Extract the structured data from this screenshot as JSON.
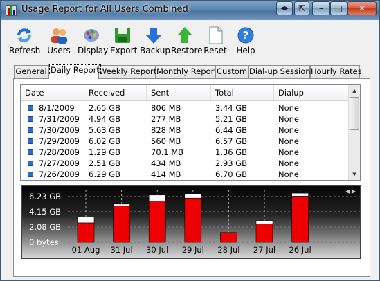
{
  "window": {
    "title": "Usage Report for All Users Combined",
    "buttons": {
      "nav": "◀▶",
      "restore": "⇱",
      "minimize": "–",
      "maximize": "□",
      "close": "✕"
    }
  },
  "toolbar": [
    {
      "label": "Refresh",
      "icon": "refresh-icon"
    },
    {
      "label": "Users",
      "icon": "users-icon"
    },
    {
      "label": "Display",
      "icon": "display-icon"
    },
    {
      "label": "Export",
      "icon": "export-icon"
    },
    {
      "label": "Backup",
      "icon": "backup-icon"
    },
    {
      "label": "Restore",
      "icon": "restore-icon"
    },
    {
      "label": "Reset",
      "icon": "reset-icon"
    },
    {
      "label": "Help",
      "icon": "help-icon"
    }
  ],
  "tabs": [
    "General",
    "Daily Report",
    "Weekly Report",
    "Monthly Report",
    "Custom",
    "Dial-up Sessions",
    "Hourly Rates"
  ],
  "active_tab": "Daily Report",
  "table": {
    "columns": [
      "Date",
      "Received",
      "Sent",
      "Total",
      "Dialup"
    ],
    "rows": [
      [
        "8/1/2009",
        "2.65 GB",
        "806 MB",
        "3.44 GB",
        "None"
      ],
      [
        "7/31/2009",
        "4.94 GB",
        "277 MB",
        "5.21 GB",
        "None"
      ],
      [
        "7/30/2009",
        "5.63 GB",
        "828 MB",
        "6.44 GB",
        "None"
      ],
      [
        "7/29/2009",
        "6.02 GB",
        "560 MB",
        "6.57 GB",
        "None"
      ],
      [
        "7/28/2009",
        "1.29 GB",
        "70.1 MB",
        "1.36 GB",
        "None"
      ],
      [
        "7/27/2009",
        "2.51 GB",
        "434 MB",
        "2.93 GB",
        "None"
      ],
      [
        "7/26/2009",
        "6.29 GB",
        "414 MB",
        "6.70 GB",
        "None"
      ]
    ]
  },
  "chart_data": {
    "type": "bar",
    "stacked": true,
    "categories": [
      "01 Aug",
      "31 Jul",
      "30 Jul",
      "29 Jul",
      "28 Jul",
      "27 Jul",
      "26 Jul"
    ],
    "series": [
      {
        "values": [
          2.65,
          4.94,
          5.63,
          6.02,
          1.29,
          2.51,
          6.29
        ],
        "color": "#ee0000"
      },
      {
        "values": [
          0.79,
          0.27,
          0.81,
          0.55,
          0.07,
          0.42,
          0.4
        ],
        "color": "#ffffff"
      }
    ],
    "yticks": [
      "0 bytes",
      "2.08 GB",
      "4.15 GB",
      "6.23 GB"
    ],
    "ytick_values": [
      0,
      2.08,
      4.15,
      6.23
    ],
    "ylim": [
      0,
      6.23
    ],
    "grid": true,
    "background": "black-to-gray gradient"
  },
  "colors": {
    "accent": "#ee0000",
    "row_icon": "#2a6fd0"
  }
}
